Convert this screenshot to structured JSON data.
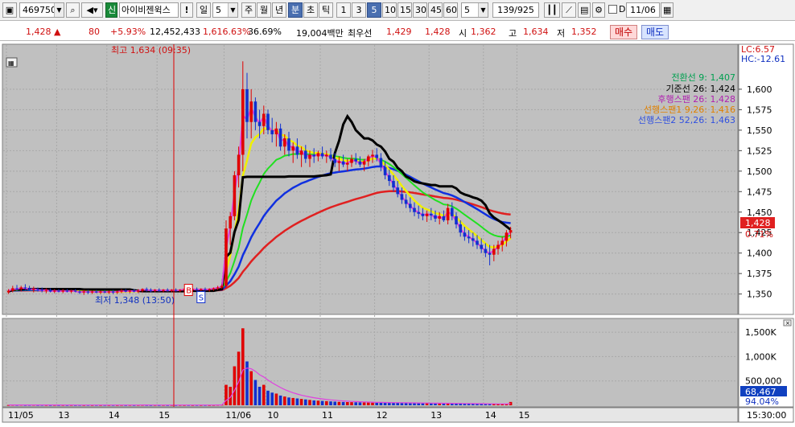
{
  "toolbar": {
    "code": "469750",
    "credit_badge": "신",
    "stock_name": "아이비젠윅스",
    "warn": "!",
    "period_day": "일",
    "period_num": "5",
    "periods": [
      "주",
      "월",
      "년",
      "분",
      "초",
      "틱"
    ],
    "active_period": "분",
    "intervals": [
      "1",
      "3",
      "5",
      "10",
      "15",
      "30",
      "45",
      "60"
    ],
    "active_interval": "5",
    "count": "5",
    "page": "139/925",
    "d_label": "D",
    "date": "11/06"
  },
  "info": {
    "price": "1,428",
    "change_arrow": "▲",
    "change": "80",
    "change_pct": "+5.93%",
    "volume": "12,452,433",
    "vol_ratio": "1,616.63%",
    "turnover": "36.69%",
    "amount": "19,004백만",
    "best_label": "최우선",
    "ask": "1,429",
    "bid": "1,428",
    "open_label": "시",
    "open": "1,362",
    "high_label": "고",
    "high": "1,634",
    "low_label": "저",
    "low": "1,352",
    "buy_label": "매수",
    "sell_label": "매도"
  },
  "chart_data": {
    "type": "candlestick",
    "price_axis": [
      1350,
      1375,
      1400,
      1425,
      1450,
      1475,
      1500,
      1525,
      1550,
      1575,
      1600
    ],
    "price_axis_labels": [
      "1,350",
      "1,375",
      "1,400",
      "1,425",
      "1,450",
      "1,475",
      "1,500",
      "1,525",
      "1,550",
      "1,575",
      "1,600"
    ],
    "ylim": [
      1330,
      1650
    ],
    "lc_label": "LC:6.57",
    "hc_label": "HC:-12.61",
    "current_price_label": "1,428",
    "current_pct_label": "0.71%",
    "high_marker": "최고 1,634 (09:35)",
    "low_marker": "최저 1,348 (13:50)",
    "ichimoku_legend": [
      {
        "label": "전환선 9: 1,407",
        "color": "#00a050"
      },
      {
        "label": "기준선 26: 1,424",
        "color": "#000000"
      },
      {
        "label": "후행스팬 26: 1,428",
        "color": "#b020b0"
      },
      {
        "label": "선행스팬1 9,26: 1,416",
        "color": "#e08000"
      },
      {
        "label": "선행스팬2 52,26: 1,463",
        "color": "#3050e0"
      }
    ],
    "buy_marker": "B",
    "sell_marker": "S",
    "time_labels": [
      "11/05",
      "13",
      "14",
      "15",
      "11/06",
      "10",
      "11",
      "12",
      "13",
      "14",
      "15"
    ],
    "cursor_time": "15:30:00",
    "volume_axis": [
      500000,
      1000000,
      1500000
    ],
    "volume_axis_labels": [
      "500,000",
      "1,000K",
      "1,500K"
    ],
    "volume_ylim": [
      0,
      1700000
    ],
    "volume_value_label": "68,467",
    "volume_pct_label": "94.04%",
    "candles": [
      [
        1352,
        1356,
        1350,
        1354
      ],
      [
        1354,
        1360,
        1352,
        1357
      ],
      [
        1357,
        1361,
        1354,
        1356
      ],
      [
        1356,
        1360,
        1353,
        1358
      ],
      [
        1358,
        1362,
        1355,
        1357
      ],
      [
        1357,
        1360,
        1354,
        1355
      ],
      [
        1355,
        1359,
        1352,
        1356
      ],
      [
        1356,
        1358,
        1353,
        1355
      ],
      [
        1355,
        1358,
        1352,
        1354
      ],
      [
        1354,
        1357,
        1351,
        1355
      ],
      [
        1355,
        1357,
        1352,
        1353
      ],
      [
        1353,
        1356,
        1351,
        1354
      ],
      [
        1354,
        1356,
        1352,
        1353
      ],
      [
        1353,
        1356,
        1351,
        1354
      ],
      [
        1354,
        1356,
        1352,
        1353
      ],
      [
        1353,
        1355,
        1351,
        1354
      ],
      [
        1354,
        1356,
        1352,
        1353
      ],
      [
        1353,
        1355,
        1350,
        1352
      ],
      [
        1352,
        1355,
        1349,
        1353
      ],
      [
        1353,
        1355,
        1350,
        1352
      ],
      [
        1352,
        1354,
        1350,
        1353
      ],
      [
        1353,
        1355,
        1351,
        1352
      ],
      [
        1352,
        1354,
        1350,
        1353
      ],
      [
        1353,
        1355,
        1351,
        1352
      ],
      [
        1352,
        1354,
        1350,
        1353
      ],
      [
        1353,
        1355,
        1350,
        1352
      ],
      [
        1352,
        1354,
        1350,
        1353
      ],
      [
        1353,
        1356,
        1351,
        1354
      ],
      [
        1354,
        1356,
        1352,
        1353
      ],
      [
        1353,
        1355,
        1351,
        1354
      ],
      [
        1354,
        1356,
        1352,
        1353
      ],
      [
        1353,
        1356,
        1351,
        1354
      ],
      [
        1354,
        1357,
        1352,
        1356
      ],
      [
        1356,
        1358,
        1353,
        1355
      ],
      [
        1355,
        1357,
        1352,
        1354
      ],
      [
        1354,
        1356,
        1352,
        1355
      ],
      [
        1355,
        1357,
        1353,
        1354
      ],
      [
        1354,
        1356,
        1352,
        1355
      ],
      [
        1355,
        1357,
        1353,
        1354
      ],
      [
        1354,
        1356,
        1352,
        1355
      ],
      [
        1355,
        1357,
        1353,
        1354
      ],
      [
        1354,
        1356,
        1352,
        1355
      ],
      [
        1355,
        1357,
        1353,
        1356
      ],
      [
        1356,
        1358,
        1354,
        1355
      ],
      [
        1355,
        1357,
        1353,
        1356
      ],
      [
        1356,
        1358,
        1354,
        1355
      ],
      [
        1355,
        1357,
        1353,
        1356
      ],
      [
        1356,
        1358,
        1354,
        1355
      ],
      [
        1355,
        1357,
        1353,
        1356
      ],
      [
        1356,
        1358,
        1354,
        1357
      ],
      [
        1357,
        1360,
        1355,
        1358
      ],
      [
        1358,
        1362,
        1356,
        1360
      ],
      [
        1360,
        1440,
        1358,
        1430
      ],
      [
        1430,
        1450,
        1410,
        1445
      ],
      [
        1445,
        1500,
        1440,
        1495
      ],
      [
        1495,
        1530,
        1480,
        1520
      ],
      [
        1520,
        1634,
        1500,
        1600
      ],
      [
        1600,
        1620,
        1540,
        1560
      ],
      [
        1560,
        1600,
        1540,
        1585
      ],
      [
        1585,
        1590,
        1550,
        1560
      ],
      [
        1560,
        1575,
        1540,
        1555
      ],
      [
        1555,
        1580,
        1545,
        1570
      ],
      [
        1570,
        1575,
        1545,
        1550
      ],
      [
        1550,
        1565,
        1535,
        1545
      ],
      [
        1545,
        1560,
        1530,
        1552
      ],
      [
        1552,
        1558,
        1525,
        1530
      ],
      [
        1530,
        1545,
        1520,
        1540
      ],
      [
        1540,
        1548,
        1518,
        1525
      ],
      [
        1525,
        1535,
        1510,
        1530
      ],
      [
        1530,
        1540,
        1515,
        1520
      ],
      [
        1520,
        1530,
        1505,
        1525
      ],
      [
        1525,
        1532,
        1510,
        1515
      ],
      [
        1515,
        1525,
        1505,
        1520
      ],
      [
        1520,
        1528,
        1510,
        1518
      ],
      [
        1518,
        1525,
        1512,
        1522
      ],
      [
        1522,
        1530,
        1515,
        1518
      ],
      [
        1518,
        1525,
        1510,
        1520
      ],
      [
        1520,
        1528,
        1512,
        1515
      ],
      [
        1515,
        1522,
        1505,
        1510
      ],
      [
        1510,
        1518,
        1500,
        1512
      ],
      [
        1512,
        1520,
        1505,
        1508
      ],
      [
        1508,
        1515,
        1500,
        1510
      ],
      [
        1510,
        1520,
        1505,
        1515
      ],
      [
        1515,
        1522,
        1508,
        1512
      ],
      [
        1512,
        1518,
        1505,
        1508
      ],
      [
        1508,
        1515,
        1500,
        1512
      ],
      [
        1512,
        1520,
        1506,
        1518
      ],
      [
        1518,
        1526,
        1510,
        1520
      ],
      [
        1520,
        1528,
        1512,
        1516
      ],
      [
        1516,
        1522,
        1500,
        1505
      ],
      [
        1505,
        1512,
        1490,
        1495
      ],
      [
        1495,
        1502,
        1482,
        1488
      ],
      [
        1488,
        1495,
        1475,
        1480
      ],
      [
        1480,
        1488,
        1468,
        1472
      ],
      [
        1472,
        1480,
        1460,
        1465
      ],
      [
        1465,
        1472,
        1455,
        1460
      ],
      [
        1460,
        1468,
        1450,
        1455
      ],
      [
        1455,
        1462,
        1445,
        1450
      ],
      [
        1450,
        1458,
        1442,
        1448
      ],
      [
        1448,
        1455,
        1440,
        1445
      ],
      [
        1445,
        1452,
        1438,
        1448
      ],
      [
        1448,
        1455,
        1440,
        1446
      ],
      [
        1446,
        1452,
        1438,
        1442
      ],
      [
        1442,
        1450,
        1435,
        1445
      ],
      [
        1445,
        1452,
        1438,
        1440
      ],
      [
        1440,
        1460,
        1435,
        1455
      ],
      [
        1455,
        1462,
        1440,
        1445
      ],
      [
        1445,
        1450,
        1430,
        1435
      ],
      [
        1435,
        1440,
        1420,
        1425
      ],
      [
        1425,
        1432,
        1415,
        1420
      ],
      [
        1420,
        1428,
        1412,
        1418
      ],
      [
        1418,
        1425,
        1408,
        1415
      ],
      [
        1415,
        1422,
        1405,
        1410
      ],
      [
        1410,
        1418,
        1400,
        1405
      ],
      [
        1405,
        1412,
        1395,
        1400
      ],
      [
        1400,
        1410,
        1385,
        1398
      ],
      [
        1398,
        1410,
        1390,
        1405
      ],
      [
        1405,
        1415,
        1398,
        1410
      ],
      [
        1410,
        1420,
        1402,
        1415
      ],
      [
        1415,
        1428,
        1408,
        1425
      ],
      [
        1425,
        1432,
        1418,
        1428
      ]
    ],
    "volumes": [
      6000,
      8000,
      7000,
      9000,
      6000,
      7000,
      8000,
      6000,
      7000,
      6000,
      5000,
      6000,
      5000,
      6000,
      5000,
      6000,
      5000,
      6000,
      5000,
      6000,
      5000,
      6000,
      5000,
      6000,
      5000,
      6000,
      5000,
      6000,
      5000,
      6000,
      5000,
      6000,
      7000,
      6000,
      5000,
      6000,
      5000,
      6000,
      5000,
      6000,
      5000,
      6000,
      5000,
      6000,
      5000,
      6000,
      5000,
      6000,
      5000,
      6000,
      9000,
      12000,
      420000,
      380000,
      800000,
      1100000,
      1580000,
      900000,
      700000,
      520000,
      380000,
      420000,
      300000,
      260000,
      240000,
      200000,
      180000,
      160000,
      150000,
      140000,
      130000,
      120000,
      110000,
      100000,
      95000,
      90000,
      85000,
      80000,
      75000,
      70000,
      68000,
      66000,
      64000,
      62000,
      60000,
      58000,
      56000,
      55000,
      54000,
      53000,
      52000,
      51000,
      50000,
      49000,
      48000,
      47000,
      46000,
      45000,
      44000,
      43000,
      42000,
      41000,
      40000,
      39000,
      38000,
      37000,
      36000,
      35000,
      34000,
      33000,
      32000,
      31000,
      30000,
      29000,
      28000,
      27000,
      26000,
      25000,
      24000,
      23000,
      68467
    ]
  }
}
